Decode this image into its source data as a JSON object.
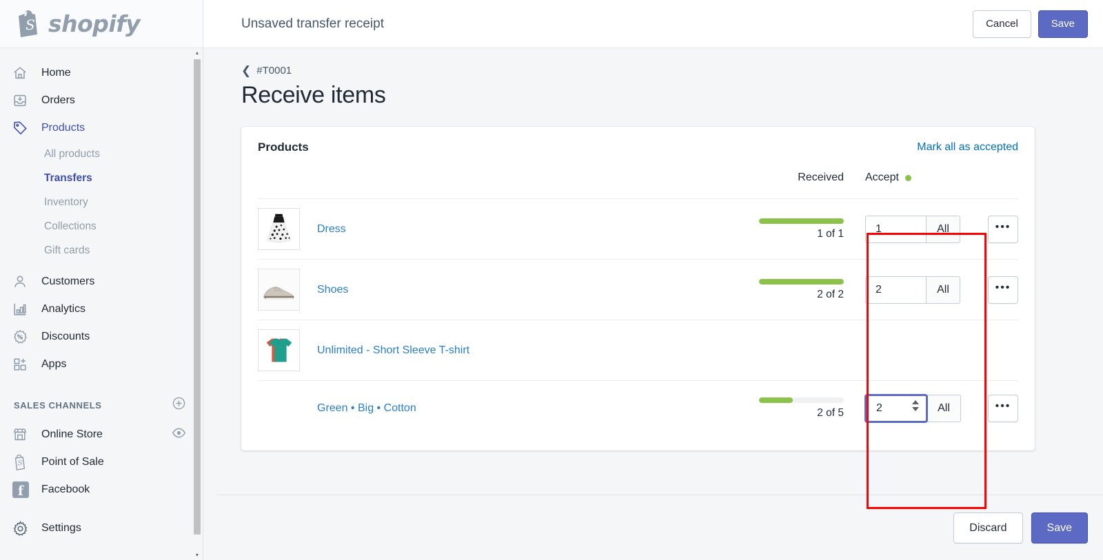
{
  "brand": {
    "name": "shopify",
    "logo_icon": "shopify-bag-icon"
  },
  "sidebar": {
    "nav": [
      {
        "label": "Home",
        "icon": "home-icon"
      },
      {
        "label": "Orders",
        "icon": "orders-inbox-icon"
      },
      {
        "label": "Products",
        "icon": "tag-icon",
        "active": true
      }
    ],
    "product_subitems": [
      {
        "label": "All products",
        "active": false
      },
      {
        "label": "Transfers",
        "active": true
      },
      {
        "label": "Inventory",
        "active": false
      },
      {
        "label": "Collections",
        "active": false
      },
      {
        "label": "Gift cards",
        "active": false
      }
    ],
    "nav2": [
      {
        "label": "Customers",
        "icon": "person-icon"
      },
      {
        "label": "Analytics",
        "icon": "bar-chart-icon"
      },
      {
        "label": "Discounts",
        "icon": "discount-badge-icon"
      },
      {
        "label": "Apps",
        "icon": "apps-grid-plus-icon"
      }
    ],
    "sales_channels_heading": "SALES CHANNELS",
    "sales_channels_add_icon": "plus-circle-icon",
    "channels": [
      {
        "label": "Online Store",
        "icon": "storefront-icon",
        "trailing_icon": "eye-icon"
      },
      {
        "label": "Point of Sale",
        "icon": "pos-bag-icon",
        "trailing_icon": ""
      },
      {
        "label": "Facebook",
        "icon": "facebook-icon",
        "trailing_icon": ""
      }
    ],
    "settings": {
      "label": "Settings",
      "icon": "gear-icon"
    }
  },
  "topbar": {
    "title": "Unsaved transfer receipt",
    "cancel_label": "Cancel",
    "save_label": "Save"
  },
  "page": {
    "breadcrumb": "#T0001",
    "breadcrumb_icon": "chevron-left-icon",
    "title": "Receive items"
  },
  "card": {
    "title": "Products",
    "mark_all_label": "Mark all as accepted",
    "columns": {
      "received": "Received",
      "accept": "Accept",
      "accept_status_icon": "green-dot-icon"
    },
    "rows": [
      {
        "name": "Dress",
        "thumb_icon": "dress-thumbnail",
        "received_text": "1 of 1",
        "received_pct": 100,
        "qty_value": "1",
        "all_label": "All",
        "more_label": "•••",
        "focused": false,
        "is_variant": false,
        "has_controls": true
      },
      {
        "name": "Shoes",
        "thumb_icon": "shoe-thumbnail",
        "received_text": "2 of 2",
        "received_pct": 100,
        "qty_value": "2",
        "all_label": "All",
        "more_label": "•••",
        "focused": false,
        "is_variant": false,
        "has_controls": true
      },
      {
        "name": "Unlimited - Short Sleeve T-shirt",
        "thumb_icon": "tshirt-thumbnail",
        "received_text": "",
        "received_pct": 0,
        "qty_value": "",
        "all_label": "",
        "more_label": "",
        "focused": false,
        "is_variant": false,
        "has_controls": false
      },
      {
        "name": "Green • Big • Cotton",
        "thumb_icon": "",
        "received_text": "2 of 5",
        "received_pct": 40,
        "qty_value": "2",
        "all_label": "All",
        "more_label": "•••",
        "focused": true,
        "is_variant": true,
        "has_controls": true
      }
    ]
  },
  "bottom": {
    "discard_label": "Discard",
    "save_label": "Save"
  },
  "colors": {
    "accent": "#5c6ac4",
    "link": "#006fbb",
    "product_link": "#2a80c4",
    "progress_green": "#8bc34a",
    "annotation_red": "#ff0000",
    "sidebar_bg": "#f4f6f8"
  }
}
